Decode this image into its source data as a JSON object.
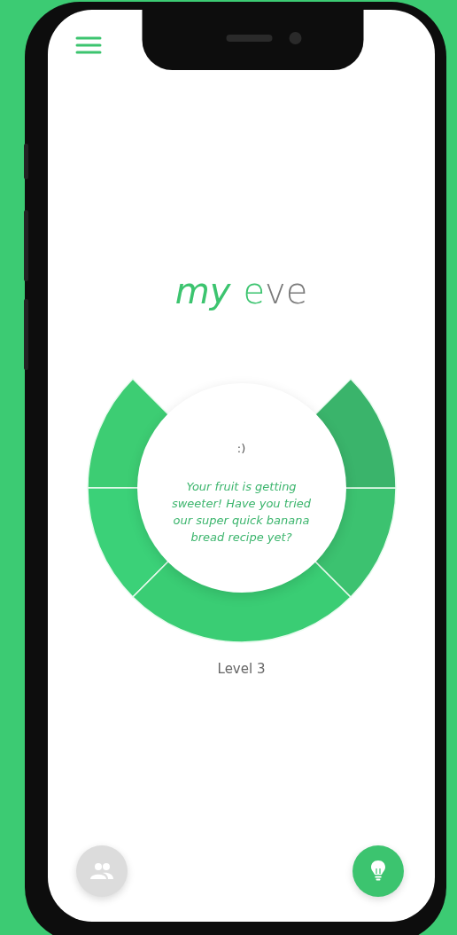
{
  "logo": [
    {
      "text": "my",
      "color": "#3cc46f",
      "italic": true
    },
    {
      "text": "e",
      "color": "#3cc46f",
      "italic": false
    },
    {
      "text": "ve",
      "color": "#7a7a7a",
      "italic": false
    }
  ],
  "gauge": {
    "segments": [
      {
        "color": "#3dcd73"
      },
      {
        "color": "#3bd178"
      },
      {
        "color": "#3acd74"
      },
      {
        "color": "#3cc270"
      },
      {
        "color": "#3ab46b"
      }
    ],
    "face": ":)",
    "message": "Your fruit is getting sweeter! Have you tried our super quick banana bread recipe yet?"
  },
  "level": "Level 3"
}
